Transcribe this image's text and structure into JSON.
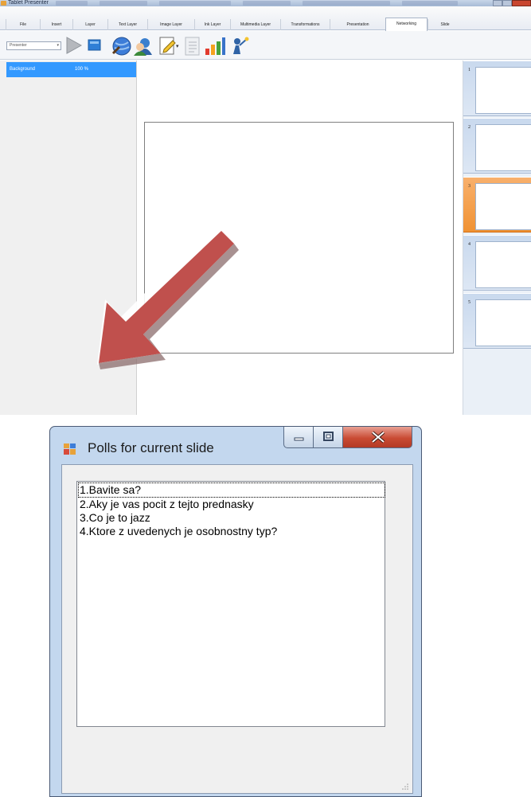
{
  "app": {
    "title": "Tablet Presenter",
    "ribbon_tabs": [
      {
        "label": "File",
        "active": false
      },
      {
        "label": "Insert",
        "active": false
      },
      {
        "label": "Layer",
        "active": false
      },
      {
        "label": "Text Layer",
        "active": false
      },
      {
        "label": "Image Layer",
        "active": false
      },
      {
        "label": "Ink Layer",
        "active": false
      },
      {
        "label": "Multimedia Layer",
        "active": false
      },
      {
        "label": "Transformations",
        "active": false
      },
      {
        "label": "Presentation",
        "active": false
      },
      {
        "label": "Networking",
        "active": true
      },
      {
        "label": "Slide",
        "active": false
      }
    ],
    "mode_select": {
      "value": "Presenter"
    },
    "toolbar_icons": [
      "play-icon",
      "stop-icon",
      "globe-icon",
      "user-icon",
      "note-icon",
      "list-icon",
      "bar-chart-icon",
      "poll-icon"
    ],
    "layers": [
      {
        "name": "Background",
        "opacity": "100 %"
      }
    ],
    "slides": [
      {
        "number": "1",
        "selected": false
      },
      {
        "number": "2",
        "selected": false
      },
      {
        "number": "3",
        "selected": true
      },
      {
        "number": "4",
        "selected": false
      },
      {
        "number": "5",
        "selected": false
      }
    ],
    "accent_colors": {
      "selection": "#3399ff",
      "selected_slide": "#f09233",
      "arrow": "#c0504d"
    }
  },
  "dialog": {
    "title": "Polls for current slide",
    "controls": [
      "minimize-icon",
      "maximize-icon",
      "close-icon"
    ],
    "polls": [
      "1.Bavite sa?",
      "2.Aky je vas pocit z tejto prednasky",
      "3.Co je to jazz",
      "4.Ktore z uvedenych je osobnostny typ?"
    ],
    "selected_index": 0
  }
}
